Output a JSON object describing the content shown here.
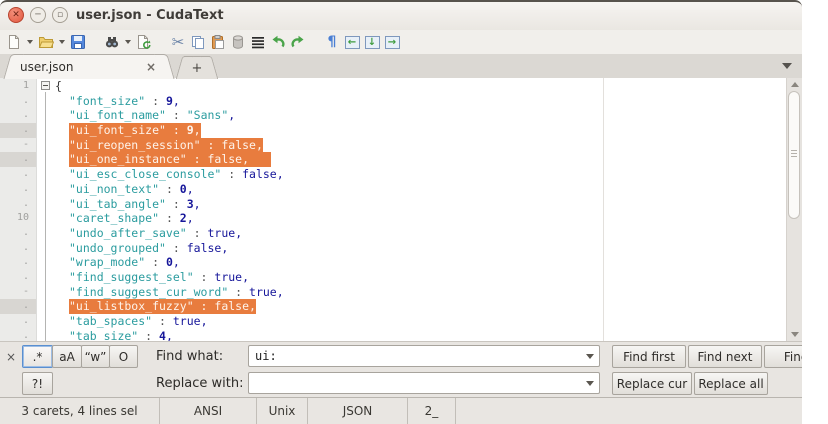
{
  "window": {
    "title": "user.json - CudaText"
  },
  "toolbar": {
    "icon_names": [
      "new-file",
      "open-file",
      "save-file",
      "find",
      "reload-file",
      "cut",
      "copy",
      "paste",
      "delete",
      "select-all",
      "undo",
      "redo",
      "show-nonprinting",
      "unindent",
      "move-down",
      "indent"
    ],
    "pilcrow": "¶",
    "cut_glyph": "✂",
    "box_arrows": [
      "←",
      "↓",
      "→"
    ]
  },
  "tabbar": {
    "tabs": [
      {
        "label": "user.json",
        "close": "×"
      }
    ],
    "new_tab_label": "+"
  },
  "editor": {
    "colors": {
      "selection": "#e87c3e",
      "string": "#2b9c9f",
      "number": "#16169a"
    },
    "lines": [
      {
        "g": "1",
        "ind": false,
        "tokens": [
          [
            "brace",
            "{"
          ]
        ]
      },
      {
        "g": ".",
        "ind": true,
        "tokens": [
          [
            "key",
            "\"font_size\""
          ],
          [
            "op",
            " : "
          ],
          [
            "num",
            "9"
          ],
          [
            "val",
            ","
          ]
        ]
      },
      {
        "g": ".",
        "ind": true,
        "tokens": [
          [
            "key",
            "\"ui_font_name\""
          ],
          [
            "op",
            " : "
          ],
          [
            "str",
            "\"Sans\""
          ],
          [
            "val",
            ","
          ]
        ]
      },
      {
        "g": ".",
        "ind": true,
        "sel": true,
        "caret": true,
        "tokens": [
          [
            "key",
            "\"ui_font_size\""
          ],
          [
            "op",
            " : "
          ],
          [
            "num",
            "9"
          ],
          [
            "val",
            ","
          ]
        ]
      },
      {
        "g": "-",
        "ind": true,
        "sel": true,
        "tokens": [
          [
            "key",
            "\"ui_reopen_session\""
          ],
          [
            "op",
            " : "
          ],
          [
            "kw",
            "false"
          ],
          [
            "val",
            ","
          ]
        ]
      },
      {
        "g": ".",
        "ind": true,
        "sel": true,
        "caret": true,
        "selext": true,
        "tokens": [
          [
            "key",
            "\"ui_one_instance\""
          ],
          [
            "op",
            " : "
          ],
          [
            "kw",
            "false"
          ],
          [
            "val",
            ","
          ]
        ]
      },
      {
        "g": ".",
        "ind": true,
        "tokens": [
          [
            "key",
            "\"ui_esc_close_console\""
          ],
          [
            "op",
            " : "
          ],
          [
            "kw",
            "false"
          ],
          [
            "val",
            ","
          ]
        ]
      },
      {
        "g": ".",
        "ind": true,
        "tokens": [
          [
            "key",
            "\"ui_non_text\""
          ],
          [
            "op",
            " : "
          ],
          [
            "num",
            "0"
          ],
          [
            "val",
            ","
          ]
        ]
      },
      {
        "g": ".",
        "ind": true,
        "tokens": [
          [
            "key",
            "\"ui_tab_angle\""
          ],
          [
            "op",
            " : "
          ],
          [
            "num",
            "3"
          ],
          [
            "val",
            ","
          ]
        ]
      },
      {
        "g": "10",
        "ind": true,
        "tokens": [
          [
            "key",
            "\"caret_shape\""
          ],
          [
            "op",
            " : "
          ],
          [
            "num",
            "2"
          ],
          [
            "val",
            ","
          ]
        ]
      },
      {
        "g": ".",
        "ind": true,
        "tokens": [
          [
            "key",
            "\"undo_after_save\""
          ],
          [
            "op",
            " : "
          ],
          [
            "kw",
            "true"
          ],
          [
            "val",
            ","
          ]
        ]
      },
      {
        "g": ".",
        "ind": true,
        "tokens": [
          [
            "key",
            "\"undo_grouped\""
          ],
          [
            "op",
            " : "
          ],
          [
            "kw",
            "false"
          ],
          [
            "val",
            ","
          ]
        ]
      },
      {
        "g": ".",
        "ind": true,
        "tokens": [
          [
            "key",
            "\"wrap_mode\""
          ],
          [
            "op",
            " : "
          ],
          [
            "num",
            "0"
          ],
          [
            "val",
            ","
          ]
        ]
      },
      {
        "g": ".",
        "ind": true,
        "tokens": [
          [
            "key",
            "\"find_suggest_sel\""
          ],
          [
            "op",
            " : "
          ],
          [
            "kw",
            "true"
          ],
          [
            "val",
            ","
          ]
        ]
      },
      {
        "g": "-",
        "ind": true,
        "tokens": [
          [
            "key",
            "\"find_suggest_cur_word\""
          ],
          [
            "op",
            " : "
          ],
          [
            "kw",
            "true"
          ],
          [
            "val",
            ","
          ]
        ]
      },
      {
        "g": ".",
        "ind": true,
        "sel": true,
        "caret": true,
        "tokens": [
          [
            "key",
            "\"ui_listbox_fuzzy\""
          ],
          [
            "op",
            " : "
          ],
          [
            "kw",
            "false"
          ],
          [
            "val",
            ","
          ]
        ]
      },
      {
        "g": ".",
        "ind": true,
        "tokens": [
          [
            "key",
            "\"tab_spaces\""
          ],
          [
            "op",
            " : "
          ],
          [
            "kw",
            "true"
          ],
          [
            "val",
            ","
          ]
        ]
      },
      {
        "g": ".",
        "ind": true,
        "tokens": [
          [
            "key",
            "\"tab_size\""
          ],
          [
            "op",
            " : "
          ],
          [
            "num",
            "4"
          ],
          [
            "val",
            ","
          ]
        ]
      }
    ]
  },
  "find_panel": {
    "close_label": "×",
    "options": [
      {
        "label": ".*",
        "active": true
      },
      {
        "label": "aA",
        "active": false
      },
      {
        "label": "“w”",
        "active": false
      },
      {
        "label": "O",
        "active": false
      }
    ],
    "confirm_label": "?!",
    "find_label": "Find what:",
    "replace_label": "Replace with:",
    "find_value": "ui:",
    "replace_value": "",
    "find_buttons": [
      "Find first",
      "Find next",
      "Find prev"
    ],
    "replace_buttons": [
      "Replace cur",
      "Replace all"
    ]
  },
  "statusbar": {
    "cells": [
      "3 carets, 4 lines sel",
      "ANSI",
      "Unix",
      "JSON",
      "2_",
      ""
    ]
  }
}
